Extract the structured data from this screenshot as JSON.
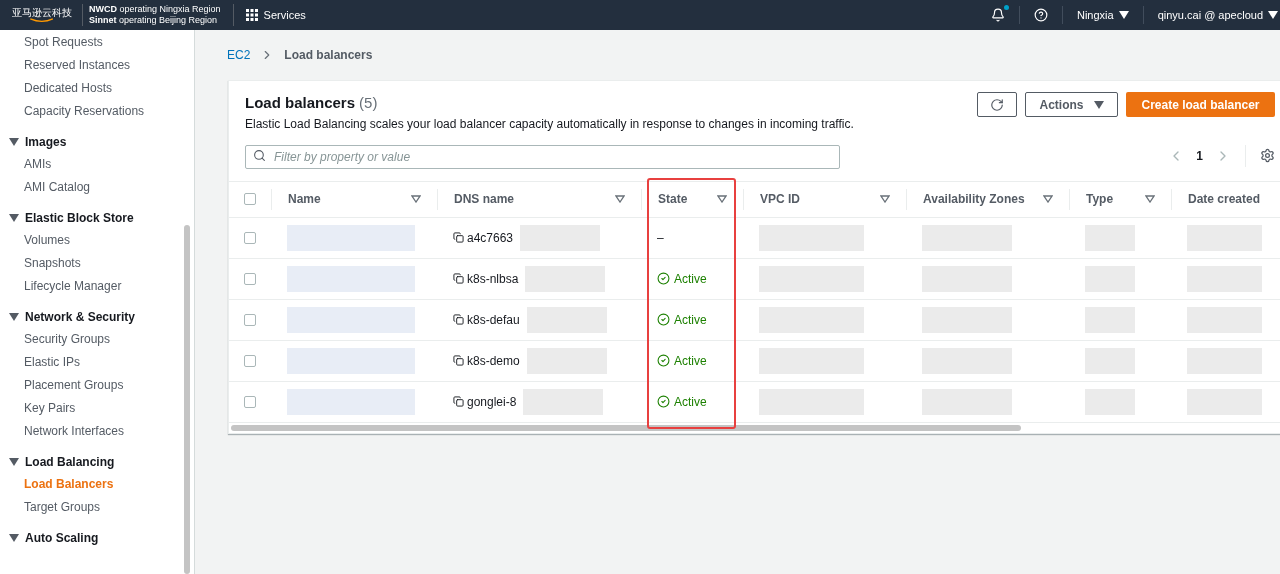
{
  "top_bar": {
    "logo_text": "亚马逊云科技",
    "operators": [
      {
        "name": "NWCD",
        "text": "operating Ningxia Region"
      },
      {
        "name": "Sinnet",
        "text": "operating Beijing Region"
      }
    ],
    "services": "Services",
    "notifications_unread": true,
    "region": "Ningxia",
    "account": "qinyu.cai @ apecloud"
  },
  "sidebar": {
    "items": [
      {
        "label": "Spot Requests",
        "selected": false
      },
      {
        "label": "Reserved Instances",
        "selected": false
      },
      {
        "label": "Dedicated Hosts",
        "selected": false
      },
      {
        "label": "Capacity Reservations",
        "selected": false
      }
    ],
    "sections": [
      {
        "title": "Images",
        "expanded": true,
        "items": [
          {
            "label": "AMIs",
            "selected": false
          },
          {
            "label": "AMI Catalog",
            "selected": false
          }
        ]
      },
      {
        "title": "Elastic Block Store",
        "expanded": true,
        "items": [
          {
            "label": "Volumes",
            "selected": false
          },
          {
            "label": "Snapshots",
            "selected": false
          },
          {
            "label": "Lifecycle Manager",
            "selected": false
          }
        ]
      },
      {
        "title": "Network & Security",
        "expanded": true,
        "items": [
          {
            "label": "Security Groups",
            "selected": false
          },
          {
            "label": "Elastic IPs",
            "selected": false
          },
          {
            "label": "Placement Groups",
            "selected": false
          },
          {
            "label": "Key Pairs",
            "selected": false
          },
          {
            "label": "Network Interfaces",
            "selected": false
          }
        ]
      },
      {
        "title": "Load Balancing",
        "expanded": true,
        "items": [
          {
            "label": "Load Balancers",
            "selected": true
          },
          {
            "label": "Target Groups",
            "selected": false
          }
        ]
      },
      {
        "title": "Auto Scaling",
        "expanded": true
      }
    ]
  },
  "breadcrumb": [
    {
      "label": "EC2",
      "link": true
    },
    {
      "label": "Load balancers",
      "link": false
    }
  ],
  "panel": {
    "title": "Load balancers",
    "count": "(5)",
    "description": "Elastic Load Balancing scales your load balancer capacity automatically in response to changes in incoming traffic.",
    "actions_button": "Actions",
    "create_button": "Create load balancer",
    "filter": {
      "placeholder": "Filter by property or value"
    },
    "page": "1",
    "table": {
      "select_all_checked": false,
      "columns": [
        {
          "label": "Name",
          "sortable": true
        },
        {
          "label": "DNS name",
          "sortable": true
        },
        {
          "label": "State",
          "sortable": true
        },
        {
          "label": "VPC ID",
          "sortable": true
        },
        {
          "label": "Availability Zones",
          "sortable": true
        },
        {
          "label": "Type",
          "sortable": true
        },
        {
          "label": "Date created",
          "sortable": false
        }
      ],
      "rows": [
        {
          "selected": false,
          "dns_name": "a4c7663",
          "state": "–",
          "kind": "none"
        },
        {
          "selected": false,
          "dns_name": "k8s-nlbsa",
          "state": "Active",
          "kind": "active"
        },
        {
          "selected": false,
          "dns_name": "k8s-defau",
          "state": "Active",
          "kind": "active"
        },
        {
          "selected": false,
          "dns_name": "k8s-demo",
          "state": "Active",
          "kind": "active"
        },
        {
          "selected": false,
          "dns_name": "gonglei-8",
          "state": "Active",
          "kind": "active"
        }
      ]
    }
  }
}
